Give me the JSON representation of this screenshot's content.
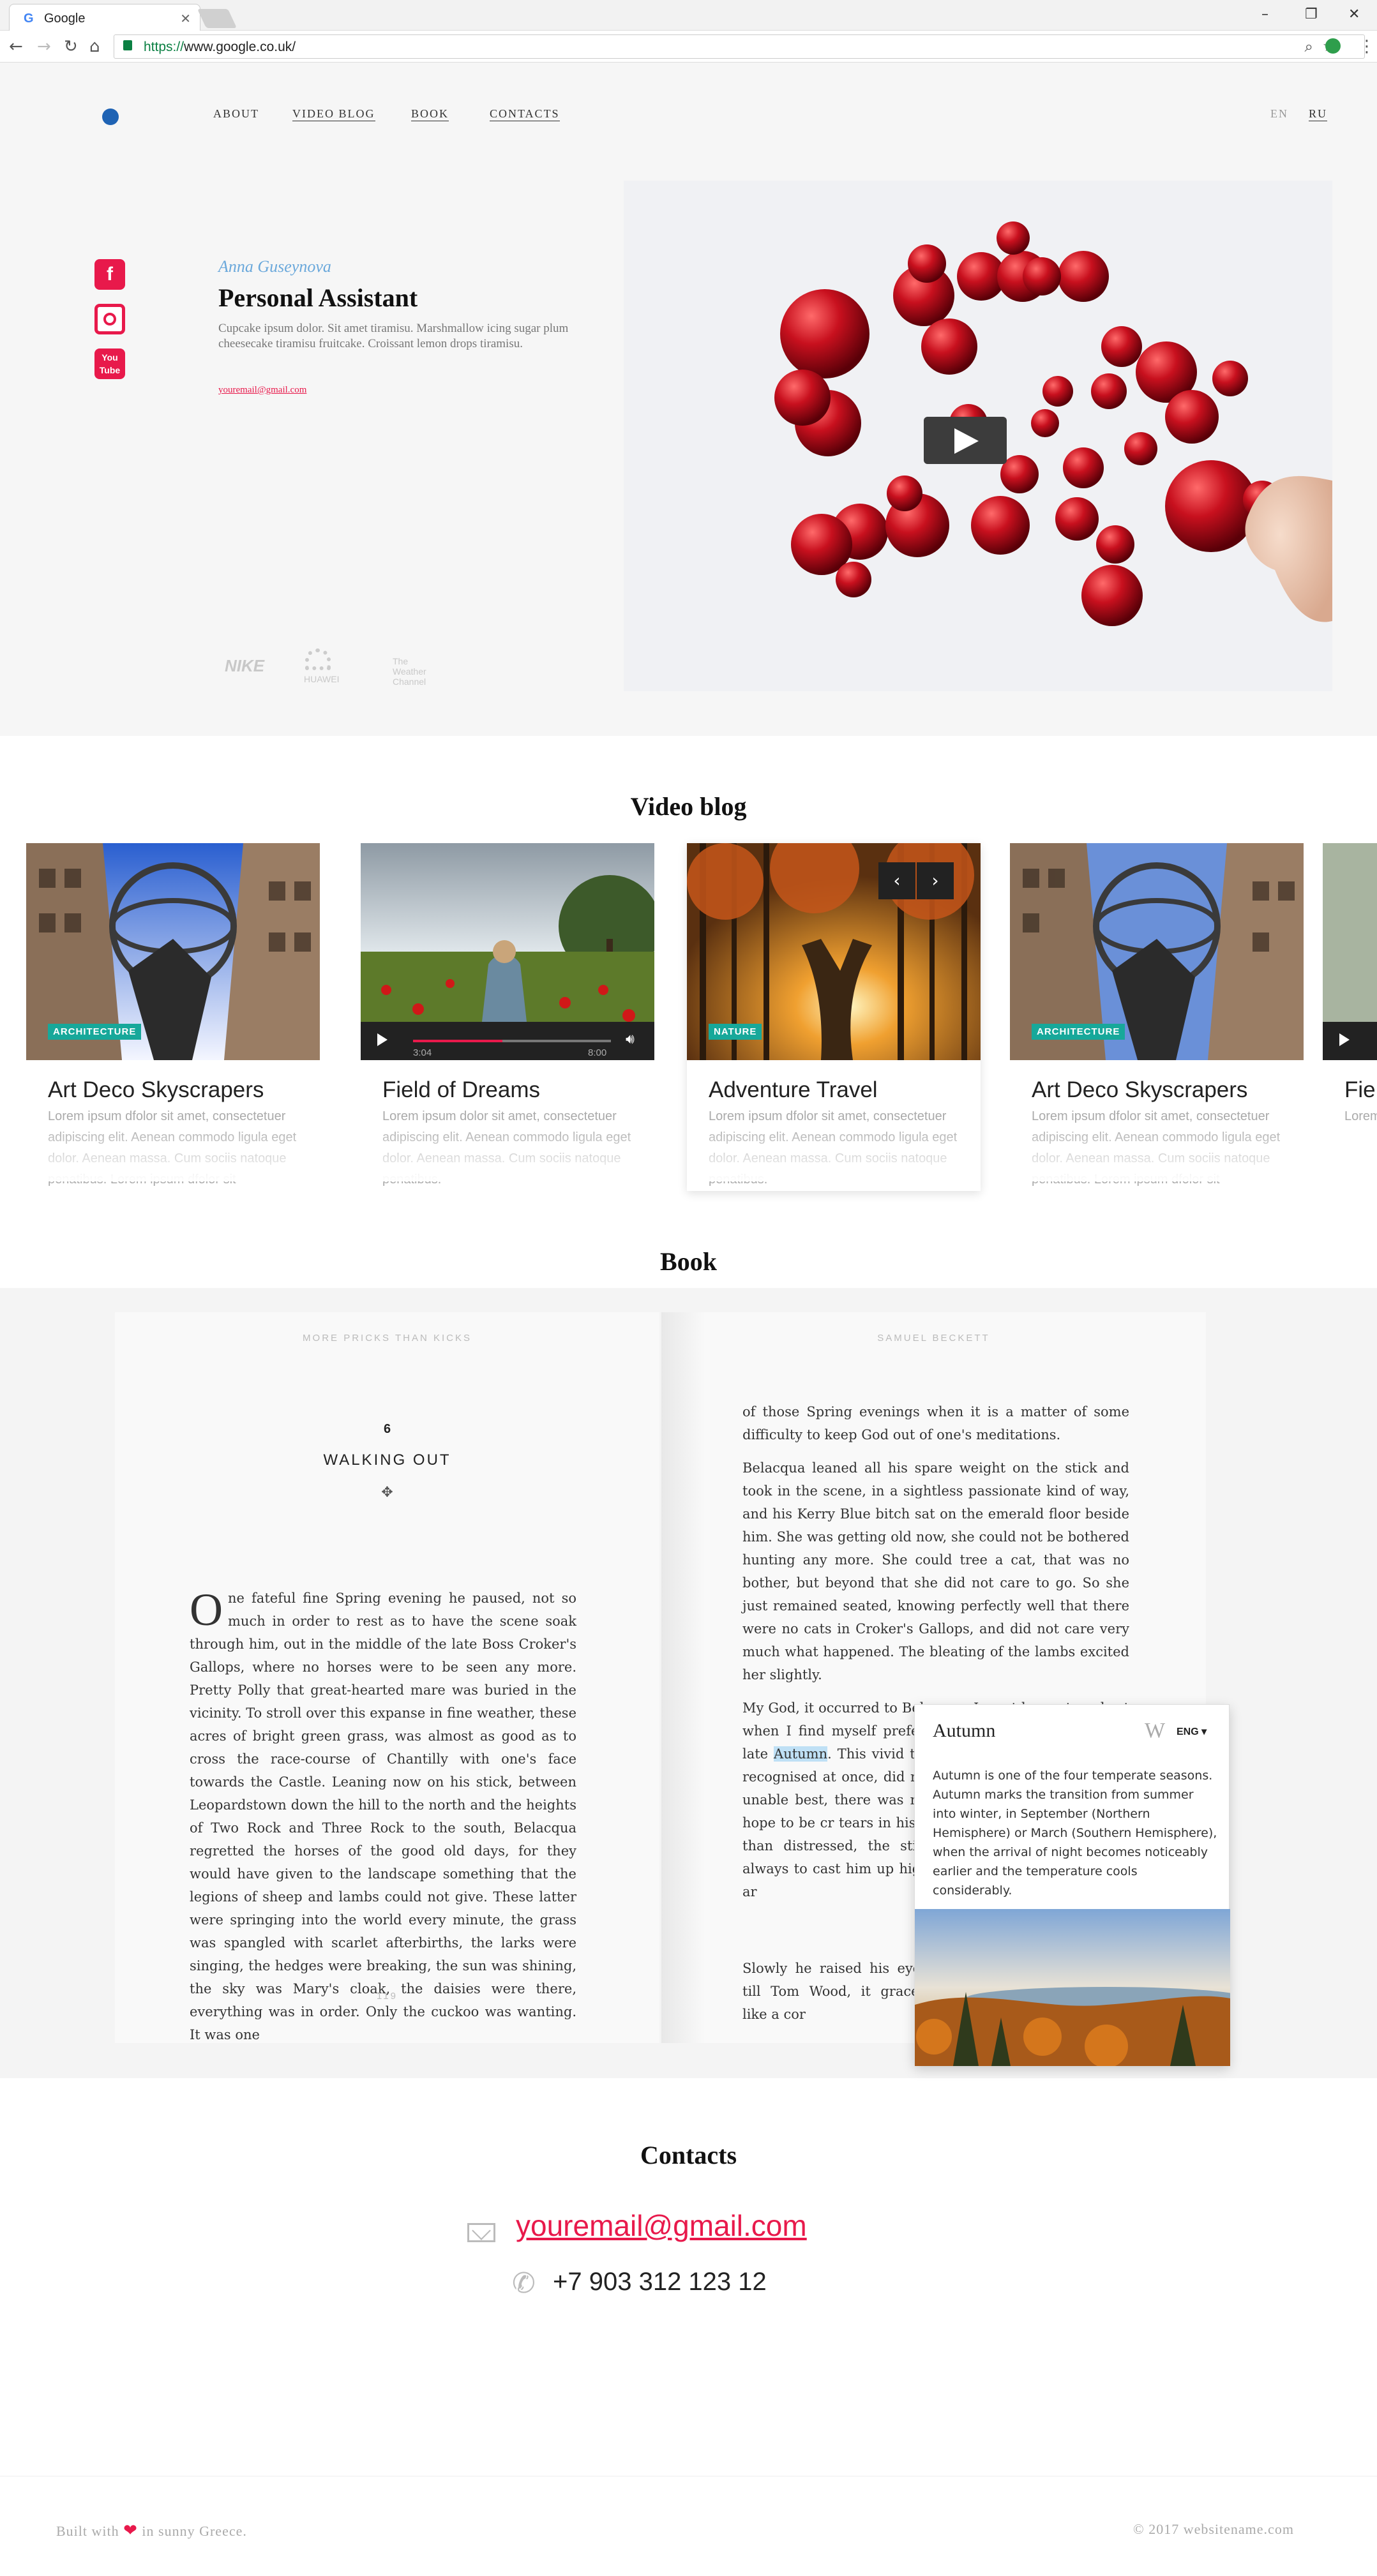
{
  "browser": {
    "tab_title": "Google",
    "url_scheme": "https://",
    "url_rest": "www.google.co.uk/"
  },
  "nav": {
    "items": [
      "ABOUT",
      "VIDEO BLOG",
      "BOOK",
      "CONTACTS"
    ],
    "langs": [
      "EN",
      "RU"
    ]
  },
  "hero": {
    "author": "Anna Guseynova",
    "title": "Personal Assistant",
    "description": "Cupcake ipsum dolor. Sit amet tiramisu. Marshmallow icing sugar plum cheesecake tiramisu fruitcake. Croissant lemon drops tiramisu.",
    "email": "youremail@gmail.com",
    "social_icons": [
      "facebook-icon",
      "instagram-icon",
      "youtube-icon"
    ],
    "brands": [
      "NIKE",
      "HUAWEI",
      "The Weather Channel"
    ]
  },
  "video_blog": {
    "title": "Video blog",
    "cards": [
      {
        "title": "Art Deco Skyscrapers",
        "badge": "ARCHITECTURE",
        "text": "Lorem ipsum dfolor sit amet, consectetuer adipiscing elit. Aenean commodo ligula eget dolor. Aenean massa. Cum sociis natoque penatibus. Lorem ipsum dfolor sit"
      },
      {
        "title": "Field of Dreams",
        "time_current": "3:04",
        "time_total": "8:00",
        "progress": 0.45,
        "text": "Lorem ipsum dolor sit amet, consectetuer adipiscing elit. Aenean commodo ligula eget dolor. Aenean massa. Cum sociis natoque penatibus."
      },
      {
        "title": "Adventure Travel",
        "badge": "NATURE",
        "text": "Lorem ipsum dfolor sit amet, consectetuer adipiscing elit. Aenean commodo ligula eget dolor. Aenean massa. Cum sociis natoque penatibus."
      },
      {
        "title": "Art Deco Skyscrapers",
        "badge": "ARCHITECTURE",
        "text": "Lorem ipsum dfolor sit amet, consectetuer adipiscing elit. Aenean commodo ligula eget dolor. Aenean massa. Cum sociis natoque penatibus. Lorem ipsum dfolor sit"
      },
      {
        "title": "Fie",
        "text": "Lorem ad eget"
      }
    ]
  },
  "book": {
    "title": "Book",
    "left_head": "MORE PRICKS THAN KICKS",
    "right_head": "SAMUEL BECKETT",
    "chapter_num": "6",
    "chapter_title": "WALKING OUT",
    "drop_cap": "O",
    "left_text": "ne fateful fine Spring evening he paused, not so much in order to rest as to have the scene soak through him, out in the middle of the late Boss Croker's Gallops, where no horses were to be seen any more. Pretty Polly that great-hearted mare was buried in the vicinity. To stroll over this expanse in fine weather, these acres of bright green grass, was almost as good as to cross the race-course of Chantilly with one's face towards the Castle. Leaning now on his stick, between Leopardstown down the hill to the north and the heights of Two Rock and Three Rock to the south, Belacqua regretted the horses of the good old days, for they would have given to the landscape something that the legions of sheep and lambs could not give. These latter were springing into the world every minute, the grass was spangled with scarlet afterbirths, the larks were singing, the hedges were breaking, the sun was shining, the sky was Mary's cloak, the daisies were there, everything was in order. Only the cuckoo was wanting. It was one",
    "page_num": "119",
    "right_p1": "of those Spring evenings when it is a matter of some difficulty to keep God out of one's meditations.",
    "right_p2": "Belacqua leaned all his spare weight on the stick and took in the scene, in a sightless passionate kind of way, and his Kerry Blue bitch sat on the emerald floor beside him. She was getting old now, she could not be bothered hunting any more. She could tree a cat, that was no bother, but beyond that she did not care to go. So she just remained seated, knowing perfectly well that there were no cats in Croker's Gallops, and did not care very much what happened. The bleating of the lambs excited her slightly.",
    "right_p3a": "My God, it occurred to Belacqua, I must be past my best when I find myself preferring this time of year to the late ",
    "right_p3_hl": "Autumn",
    "right_p3b": ". This vivid thought, quite irrefutable as he recognised at once, did not so distress him that he was unable best, there was nothing so very Soon he might hope to be cr tears in his eyes. Indeed pro rather elated than distressed, the stick and moving forward was always to cast him up high walked behind. She was hot ar",
    "right_p4": "Slowly he raised his eyes till Tom Wood, it graced like a cor",
    "popup": {
      "title": "Autumn",
      "source_glyph": "W",
      "lang": "ENG",
      "text": "Autumn is one of the four temperate seasons. Autumn marks the transition from summer into winter, in September (Northern Hemisphere) or March (Southern Hemisphere), when the arrival of night becomes noticeably earlier and the temperature cools considerably."
    }
  },
  "contacts": {
    "title": "Contacts",
    "email": "youremail@gmail.com",
    "phone": "+7 903 312 123 12"
  },
  "footer": {
    "left_a": "Built with",
    "left_b": "in sunny Greece.",
    "right": "© 2017 websitename.com"
  },
  "colors": {
    "accent": "#e8194b",
    "brand_blue": "#1f63b4",
    "badge": "#17a89a"
  }
}
